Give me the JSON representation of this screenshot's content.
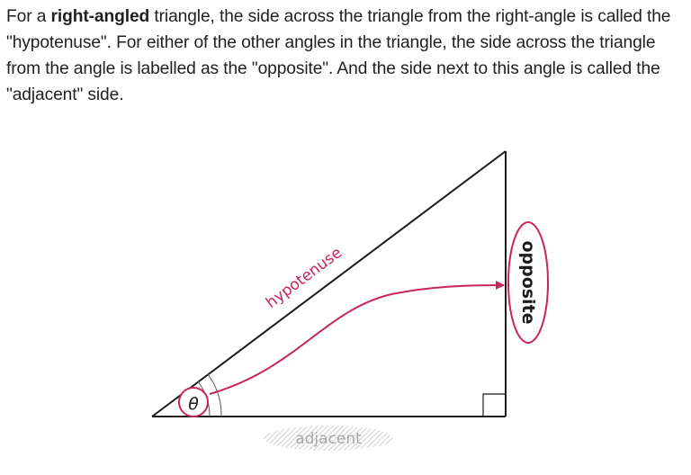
{
  "intro": {
    "part1": "For a ",
    "bold": "right-angled",
    "part2": " triangle, the side across the triangle from the right-angle is called the \"hypotenuse\". For either of the other angles in the triangle, the side across the triangle from the angle is labelled as the \"opposite\". And the side next to this angle is called the \"adjacent\" side."
  },
  "diagram": {
    "angle_symbol": "θ",
    "hypotenuse_label": "hypotenuse",
    "opposite_label": "opposite",
    "adjacent_label": "adjacent",
    "highlight_color": "#c8245e",
    "line_color": "#1c1c1c"
  }
}
